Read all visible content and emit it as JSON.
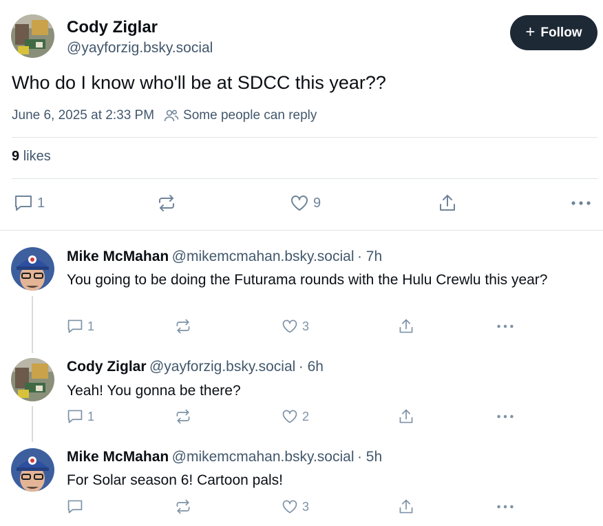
{
  "main_post": {
    "author_name": "Cody Ziglar",
    "author_handle": "@yayforzig.bsky.social",
    "follow_label": "Follow",
    "text": "Who do I know who'll be at SDCC this year??",
    "timestamp": "June 6, 2025 at 2:33 PM",
    "reply_setting": "Some people can reply",
    "likes_count": "9",
    "likes_label": "likes",
    "reply_count": "1",
    "like_count": "9"
  },
  "replies": [
    {
      "author_name": "Mike McMahan",
      "author_handle": "@mikemcmahan.bsky.social",
      "time": "· 7h",
      "text": "You going to be doing the Futurama rounds with the Hulu Crewlu this year?",
      "reply_count": "1",
      "like_count": "3"
    },
    {
      "author_name": "Cody Ziglar",
      "author_handle": "@yayforzig.bsky.social",
      "time": "· 6h",
      "text": "Yeah! You gonna be there?",
      "reply_count": "1",
      "like_count": "2"
    },
    {
      "author_name": "Mike McMahan",
      "author_handle": "@mikemcmahan.bsky.social",
      "time": "· 5h",
      "text": "For Solar season 6! Cartoon pals!",
      "reply_count": "",
      "like_count": "3"
    }
  ],
  "icons": {
    "reply": "speech-bubble-icon",
    "repost": "repost-arrows-icon",
    "like": "heart-icon",
    "share": "share-upload-icon",
    "more": "ellipsis-icon",
    "people": "people-icon",
    "plus": "plus-icon"
  },
  "colors": {
    "follow_bg": "#1e2936",
    "secondary_text": "#42576c",
    "icon": "#6f849a"
  }
}
